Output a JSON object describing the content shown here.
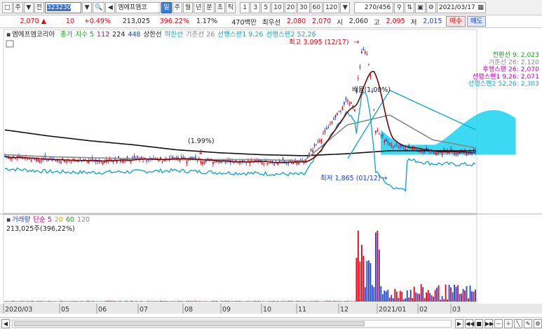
{
  "toolbar": {
    "menu_glyph": "주",
    "drop_glyph": "▼",
    "all_label": "전",
    "code": "323230",
    "stock_name": "엠에프엠코",
    "period_tabs": [
      "일",
      "주",
      "월",
      "년",
      "분",
      "초",
      "틱"
    ],
    "active_period": 0,
    "intervals": [
      "1",
      "3",
      "5",
      "10",
      "20",
      "30",
      "60",
      "120"
    ],
    "count": "270/456",
    "date": "2021/03/17"
  },
  "quote": {
    "price": "2,070",
    "arrow": "▲",
    "change": "10",
    "change_pct": "+0.49%",
    "volume": "213,025",
    "volume_ratio": "396.22%",
    "turnover": "1.17%",
    "amount": "470백만",
    "best_label": "최우선",
    "best_ask": "2,080",
    "best_bid": "2,070",
    "open_label": "시",
    "open": "2,060",
    "high_label": "고",
    "high": "2,095",
    "low_label": "저",
    "low": "2,015",
    "buy_label": "매수",
    "sell_label": "매도"
  },
  "price_panel": {
    "stock_title": "엠에프엠코리아",
    "legend": [
      {
        "text": "종가",
        "color": "#1aa21a"
      },
      {
        "text": "지수 5",
        "color": "#1aa21a"
      },
      {
        "text": "112",
        "color": "#d4007a"
      },
      {
        "text": "224",
        "color": "#222222"
      },
      {
        "text": "448",
        "color": "#1a3fd6"
      },
      {
        "text": "상한선",
        "color": "#222222"
      },
      {
        "text": "하한선",
        "color": "#1aa6c8"
      },
      {
        "text": "기준선 26",
        "color": "#888888"
      },
      {
        "text": "선행스팬1 9,26",
        "color": "#1aa6c8"
      },
      {
        "text": "선행스팬2 52,26",
        "color": "#1aa6c8"
      }
    ],
    "high_note": "최고 3,095 (12/17)",
    "low_note": "최저 1,865 (01/12)",
    "note_mid": "(1.99%)",
    "note_right": "배율(1.00%)",
    "indicators": [
      {
        "text": "전환선 9: 2,023",
        "color": "#1aa21a"
      },
      {
        "text": "기준선 26: 2,120",
        "color": "#888888"
      },
      {
        "text": "후행스팬 26: 2,070",
        "color": "#c000c0"
      },
      {
        "text": "선행스팬1 9,26: 2,071",
        "color": "#c000c0"
      },
      {
        "text": "선행스팬2 52,26: 2,303",
        "color": "#1aa6c8"
      }
    ]
  },
  "volume_panel": {
    "legend": [
      {
        "text": "거래량",
        "color": "#1a3fd6"
      },
      {
        "text": "단순 5",
        "color": "#d4007a"
      },
      {
        "text": "20",
        "color": "#e0a000"
      },
      {
        "text": "60",
        "color": "#1aa21a"
      },
      {
        "text": "120",
        "color": "#888888"
      }
    ],
    "value_text": "213,025주(396,22%)"
  },
  "xaxis": {
    "labels": [
      "2020/03",
      "05",
      "06",
      "07",
      "08",
      "09",
      "10",
      "11",
      "12",
      "2021/01",
      "02",
      "03"
    ]
  },
  "colors": {
    "up": "#e60012",
    "down": "#1a3fd6",
    "cloud": "#19d3f0"
  },
  "chart_data": {
    "type": "line",
    "title": "엠에프엠코리아",
    "x": [
      "2020/03",
      "2020/05",
      "2020/06",
      "2020/07",
      "2020/08",
      "2020/09",
      "2020/10",
      "2020/11",
      "2020/12",
      "2021/01",
      "2021/02",
      "2021/03"
    ],
    "series": [
      {
        "name": "종가",
        "values": [
          2030,
          2000,
          1990,
          2000,
          2010,
          1990,
          1980,
          1970,
          2600,
          2150,
          2080,
          2070
        ]
      },
      {
        "name": "224",
        "values": [
          2300,
          2240,
          2190,
          2150,
          2100,
          2070,
          2050,
          2040,
          2060,
          2090,
          2090,
          2090
        ]
      },
      {
        "name": "기준선 26",
        "values": [
          2050,
          2030,
          2020,
          2010,
          2000,
          2000,
          2000,
          1990,
          2350,
          2450,
          2200,
          2120
        ]
      },
      {
        "name": "선행스팬2 52,26",
        "values": [
          null,
          null,
          null,
          null,
          null,
          null,
          null,
          null,
          2000,
          2700,
          2500,
          2303
        ]
      }
    ],
    "volume": [
      20000,
      30000,
      25000,
      20000,
      30000,
      40000,
      35000,
      30000,
      3200000,
      900000,
      500000,
      213025
    ],
    "ylim_price": [
      1700,
      3200
    ]
  }
}
